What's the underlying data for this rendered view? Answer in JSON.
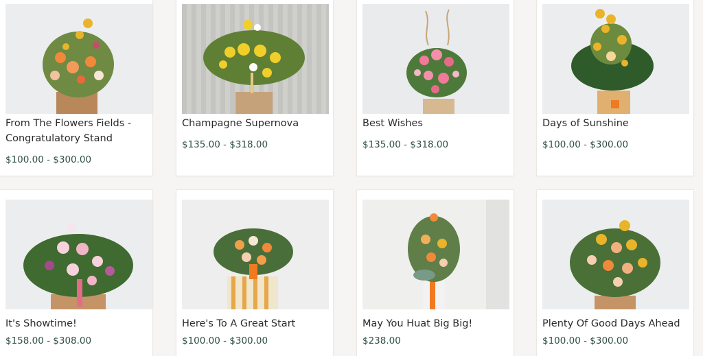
{
  "products": [
    {
      "name": "From The Flowers Fields - Congratulatory Stand",
      "price": "$100.00 - $300.00"
    },
    {
      "name": "Champagne Supernova",
      "price": "$135.00 - $318.00"
    },
    {
      "name": "Best Wishes",
      "price": "$135.00 - $318.00"
    },
    {
      "name": "Days of Sunshine",
      "price": "$100.00 - $300.00"
    },
    {
      "name": "It's Showtime!",
      "price": "$158.00 - $308.00"
    },
    {
      "name": "Here's To A Great Start",
      "price": "$100.00 - $300.00"
    },
    {
      "name": "May You Huat Big Big!",
      "price": "$238.00"
    },
    {
      "name": "Plenty Of Good Days Ahead",
      "price": "$100.00 - $300.00"
    }
  ],
  "colors": {
    "price": "#2f4f43",
    "card_border": "#ebe7e3",
    "page_bg": "#f7f5f3"
  }
}
